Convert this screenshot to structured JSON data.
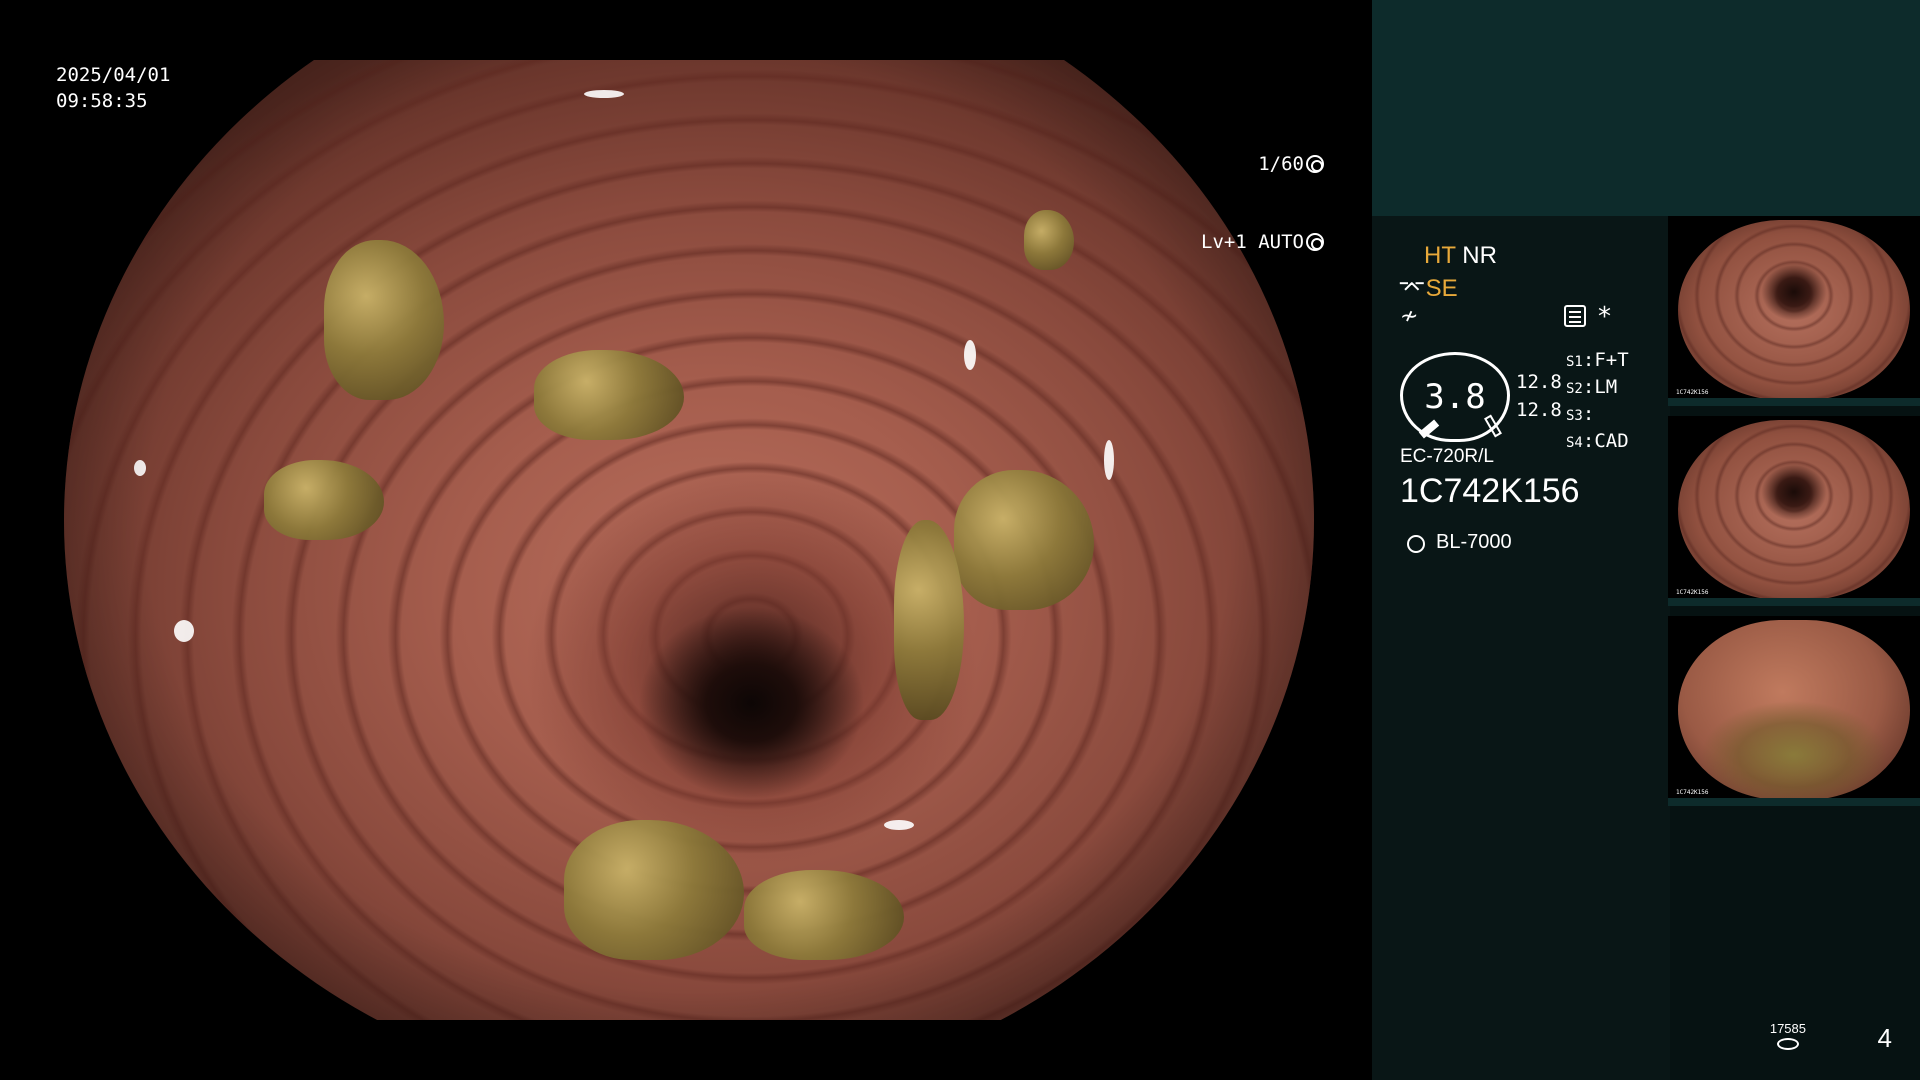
{
  "overlay": {
    "date": "2025/04/01",
    "time": "09:58:35",
    "shutter": "1/60",
    "level": "Lv+1 AUTO"
  },
  "panel": {
    "mode_ht": "HT",
    "mode_nr": "NR",
    "mode_se": "SE",
    "gauge_value": "3.8",
    "gauge_num1": "12.8",
    "gauge_num2": "12.8",
    "switches": [
      {
        "key": "S1",
        "value": "F+T"
      },
      {
        "key": "S2",
        "value": "LM"
      },
      {
        "key": "S3",
        "value": ""
      },
      {
        "key": "S4",
        "value": "CAD"
      }
    ],
    "scope_model": "EC-720R/L",
    "scope_serial": "1C742K156",
    "light_source": "BL-7000",
    "thumb_label": "1C742K156",
    "storage_count": "17585",
    "page_number": "4"
  },
  "icons": {
    "shutter_icon": "aperture-icon",
    "auto_icon": "auto-iris-icon",
    "se_icon": "structure-enhance-icon",
    "sharp_icon": "sharpness-icon",
    "record_icon": "record-icon",
    "asterisk_icon": "asterisk-icon",
    "light_icon": "light-source-icon",
    "storage_icon": "storage-disk-icon"
  },
  "colors": {
    "accent_orange": "#e8a93a",
    "panel_top": "#0d2b2b",
    "panel_bg": "#091616"
  }
}
